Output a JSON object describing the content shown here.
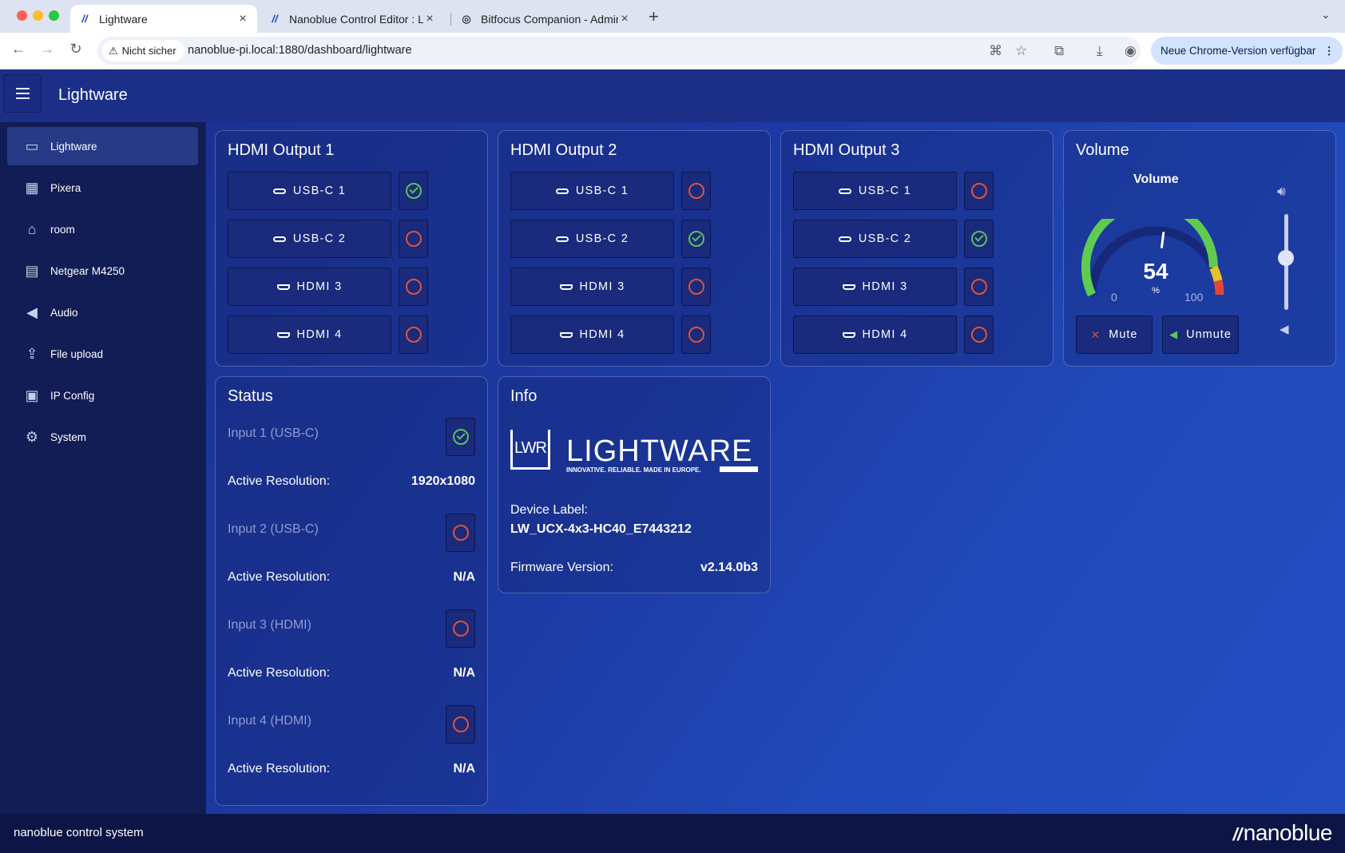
{
  "browser": {
    "tabs": [
      {
        "title": "Lightware",
        "active": true,
        "favicon": "nanoblue-icon"
      },
      {
        "title": "Nanoblue Control Editor : Lightware",
        "active": false,
        "favicon": "nanoblue-icon"
      },
      {
        "title": "Bitfocus Companion - Admin",
        "active": false,
        "favicon": "globe-icon"
      }
    ],
    "security_label": "Nicht sicher",
    "url": "nanoblue-pi.local:1880/dashboard/lightware",
    "update_label": "Neue Chrome-Version verfügbar"
  },
  "app": {
    "title": "Lightware",
    "sidebar": [
      {
        "label": "Lightware",
        "icon": "laptop-icon",
        "active": true
      },
      {
        "label": "Pixera",
        "icon": "media-server-icon",
        "active": false
      },
      {
        "label": "room",
        "icon": "home-icon",
        "active": false
      },
      {
        "label": "Netgear M4250",
        "icon": "network-switch-icon",
        "active": false
      },
      {
        "label": "Audio",
        "icon": "speaker-icon",
        "active": false
      },
      {
        "label": "File upload",
        "icon": "upload-icon",
        "active": false
      },
      {
        "label": "IP Config",
        "icon": "ip-config-icon",
        "active": false
      },
      {
        "label": "System",
        "icon": "gears-icon",
        "active": false
      }
    ],
    "outputs": [
      {
        "title": "HDMI Output 1",
        "sources": [
          {
            "label": "USB-C 1",
            "type": "usbc",
            "active": true
          },
          {
            "label": "USB-C 2",
            "type": "usbc",
            "active": false
          },
          {
            "label": "HDMI 3",
            "type": "hdmi",
            "active": false
          },
          {
            "label": "HDMI 4",
            "type": "hdmi",
            "active": false
          }
        ]
      },
      {
        "title": "HDMI Output 2",
        "sources": [
          {
            "label": "USB-C 1",
            "type": "usbc",
            "active": false
          },
          {
            "label": "USB-C 2",
            "type": "usbc",
            "active": true
          },
          {
            "label": "HDMI 3",
            "type": "hdmi",
            "active": false
          },
          {
            "label": "HDMI 4",
            "type": "hdmi",
            "active": false
          }
        ]
      },
      {
        "title": "HDMI Output 3",
        "sources": [
          {
            "label": "USB-C 1",
            "type": "usbc",
            "active": false
          },
          {
            "label": "USB-C 2",
            "type": "usbc",
            "active": true
          },
          {
            "label": "HDMI 3",
            "type": "hdmi",
            "active": false
          },
          {
            "label": "HDMI 4",
            "type": "hdmi",
            "active": false
          }
        ]
      }
    ],
    "volume": {
      "title": "Volume",
      "gauge_title": "Volume",
      "value": 54,
      "unit": "%",
      "min": 0,
      "max": 100,
      "slider_level_fraction": 0.54,
      "mute_label": "Mute",
      "unmute_label": "Unmute",
      "colors": {
        "low": "#5fcc4f",
        "mid": "#e6c229",
        "high": "#e2483a",
        "track": "#17287a"
      }
    },
    "status": {
      "title": "Status",
      "inputs": [
        {
          "label": "Input 1 (USB-C)",
          "connected": true,
          "res_label": "Active Resolution:",
          "resolution": "1920x1080"
        },
        {
          "label": "Input 2 (USB-C)",
          "connected": false,
          "res_label": "Active Resolution:",
          "resolution": "N/A"
        },
        {
          "label": "Input 3 (HDMI)",
          "connected": false,
          "res_label": "Active Resolution:",
          "resolution": "N/A"
        },
        {
          "label": "Input 4 (HDMI)",
          "connected": false,
          "res_label": "Active Resolution:",
          "resolution": "N/A"
        }
      ]
    },
    "info": {
      "title": "Info",
      "logo_text": "LIGHTWARE",
      "logo_badge": "LWR",
      "logo_tagline": "INNOVATIVE. RELIABLE. MADE IN EUROPE.",
      "device_label_caption": "Device Label:",
      "device_label": "LW_UCX-4x3-HC40_E7443212",
      "firmware_caption": "Firmware Version:",
      "firmware": "v2.14.0b3"
    },
    "footer": {
      "text": "nanoblue control system",
      "brand": "nanoblue"
    },
    "theme": {
      "accent": "#1d3aa3",
      "sidebar": "#121c55",
      "ok": "#5fbf5a",
      "off": "#e0533a"
    }
  }
}
